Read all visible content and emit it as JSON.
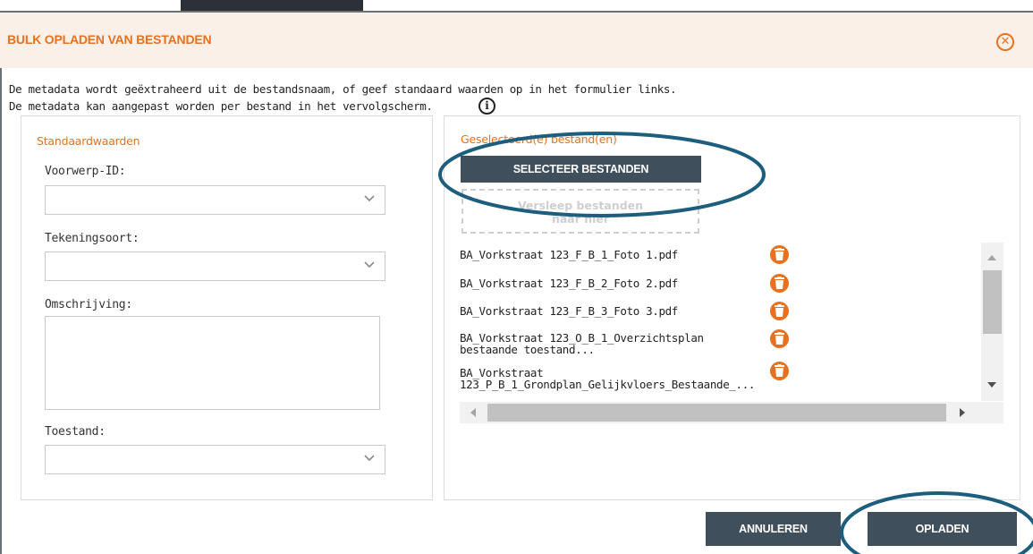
{
  "dialog": {
    "title": "BULK OPLADEN VAN BESTANDEN",
    "close_icon": "close-circle-icon",
    "close_glyph": "✕"
  },
  "intro": {
    "line1": "De metadata wordt geëxtraheerd uit de bestandsnaam, of geef standaard waarden op in het formulier links.",
    "line2": "De metadata kan aangepast worden per bestand in het vervolgscherm.",
    "info_icon": "info-icon",
    "info_glyph": "i"
  },
  "defaults": {
    "section_title": "Standaardwaarden",
    "fields": [
      {
        "label": "Voorwerp-ID:",
        "type": "select",
        "value": ""
      },
      {
        "label": "Tekeningsoort:",
        "type": "select",
        "value": ""
      },
      {
        "label": "Omschrijving:",
        "type": "textarea",
        "value": ""
      },
      {
        "label": "Toestand:",
        "type": "select",
        "value": ""
      }
    ]
  },
  "files": {
    "section_title": "Geselecteerd(e) bestand(en)",
    "select_button": "SELECTEER BESTANDEN",
    "dropzone_line1": "Versleep bestanden",
    "dropzone_line2": "naar hier",
    "items": [
      {
        "name": "BA_Vorkstraat 123_F_B_1_Foto 1.pdf"
      },
      {
        "name": "BA_Vorkstraat 123_F_B_2_Foto 2.pdf"
      },
      {
        "name": "BA_Vorkstraat 123_F_B_3_Foto 3.pdf"
      },
      {
        "name_line1": "BA_Vorkstraat 123_O_B_1_Overzichtsplan",
        "name_line2": "bestaande toestand..."
      },
      {
        "name_line1": "BA_Vorkstraat",
        "name_line2": "123_P_B_1_Grondplan_Gelijkvloers_Bestaande_..."
      }
    ],
    "delete_icon": "trash-icon"
  },
  "footer": {
    "cancel": "ANNULEREN",
    "upload": "OPLADEN"
  },
  "colors": {
    "accent": "#e8711e",
    "button": "#3f4f5b",
    "annotation": "#1d5d7e",
    "header_bg": "#faf0e8"
  }
}
